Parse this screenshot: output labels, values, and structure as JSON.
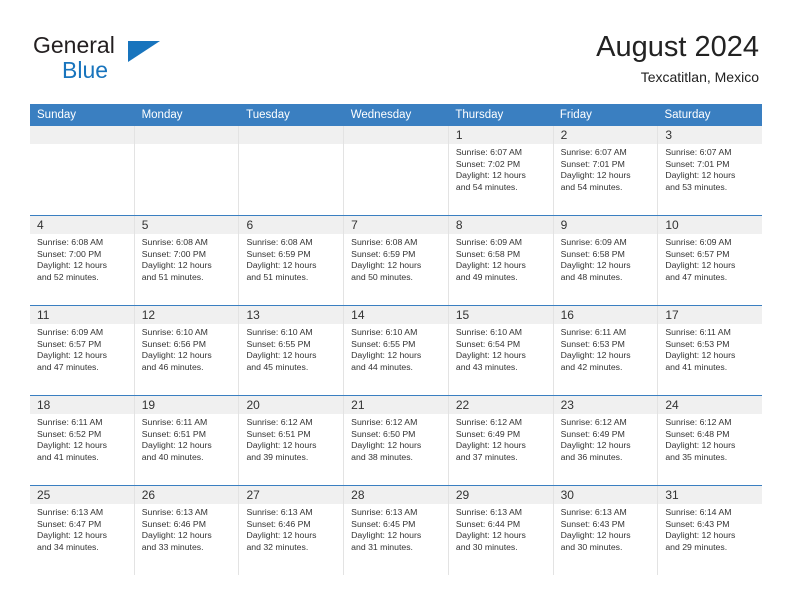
{
  "brand": {
    "name_top": "General",
    "name_bottom": "Blue",
    "triangle_color": "#1874bd",
    "top_color": "#231f20"
  },
  "header": {
    "title": "August 2024",
    "subtitle": "Texcatitlan, Mexico"
  },
  "theme": {
    "header_row_bg": "#3a7fc1",
    "header_row_text": "#ffffff",
    "daynum_bg": "#f0f0f0",
    "cell_border": "#e3e3e3",
    "row_separator": "#3a7fc1"
  },
  "weekdays": [
    "Sunday",
    "Monday",
    "Tuesday",
    "Wednesday",
    "Thursday",
    "Friday",
    "Saturday"
  ],
  "weeks": [
    [
      {
        "day": "",
        "sunrise": "",
        "sunset": "",
        "daylight1": "",
        "daylight2": ""
      },
      {
        "day": "",
        "sunrise": "",
        "sunset": "",
        "daylight1": "",
        "daylight2": ""
      },
      {
        "day": "",
        "sunrise": "",
        "sunset": "",
        "daylight1": "",
        "daylight2": ""
      },
      {
        "day": "",
        "sunrise": "",
        "sunset": "",
        "daylight1": "",
        "daylight2": ""
      },
      {
        "day": "1",
        "sunrise": "Sunrise: 6:07 AM",
        "sunset": "Sunset: 7:02 PM",
        "daylight1": "Daylight: 12 hours",
        "daylight2": "and 54 minutes."
      },
      {
        "day": "2",
        "sunrise": "Sunrise: 6:07 AM",
        "sunset": "Sunset: 7:01 PM",
        "daylight1": "Daylight: 12 hours",
        "daylight2": "and 54 minutes."
      },
      {
        "day": "3",
        "sunrise": "Sunrise: 6:07 AM",
        "sunset": "Sunset: 7:01 PM",
        "daylight1": "Daylight: 12 hours",
        "daylight2": "and 53 minutes."
      }
    ],
    [
      {
        "day": "4",
        "sunrise": "Sunrise: 6:08 AM",
        "sunset": "Sunset: 7:00 PM",
        "daylight1": "Daylight: 12 hours",
        "daylight2": "and 52 minutes."
      },
      {
        "day": "5",
        "sunrise": "Sunrise: 6:08 AM",
        "sunset": "Sunset: 7:00 PM",
        "daylight1": "Daylight: 12 hours",
        "daylight2": "and 51 minutes."
      },
      {
        "day": "6",
        "sunrise": "Sunrise: 6:08 AM",
        "sunset": "Sunset: 6:59 PM",
        "daylight1": "Daylight: 12 hours",
        "daylight2": "and 51 minutes."
      },
      {
        "day": "7",
        "sunrise": "Sunrise: 6:08 AM",
        "sunset": "Sunset: 6:59 PM",
        "daylight1": "Daylight: 12 hours",
        "daylight2": "and 50 minutes."
      },
      {
        "day": "8",
        "sunrise": "Sunrise: 6:09 AM",
        "sunset": "Sunset: 6:58 PM",
        "daylight1": "Daylight: 12 hours",
        "daylight2": "and 49 minutes."
      },
      {
        "day": "9",
        "sunrise": "Sunrise: 6:09 AM",
        "sunset": "Sunset: 6:58 PM",
        "daylight1": "Daylight: 12 hours",
        "daylight2": "and 48 minutes."
      },
      {
        "day": "10",
        "sunrise": "Sunrise: 6:09 AM",
        "sunset": "Sunset: 6:57 PM",
        "daylight1": "Daylight: 12 hours",
        "daylight2": "and 47 minutes."
      }
    ],
    [
      {
        "day": "11",
        "sunrise": "Sunrise: 6:09 AM",
        "sunset": "Sunset: 6:57 PM",
        "daylight1": "Daylight: 12 hours",
        "daylight2": "and 47 minutes."
      },
      {
        "day": "12",
        "sunrise": "Sunrise: 6:10 AM",
        "sunset": "Sunset: 6:56 PM",
        "daylight1": "Daylight: 12 hours",
        "daylight2": "and 46 minutes."
      },
      {
        "day": "13",
        "sunrise": "Sunrise: 6:10 AM",
        "sunset": "Sunset: 6:55 PM",
        "daylight1": "Daylight: 12 hours",
        "daylight2": "and 45 minutes."
      },
      {
        "day": "14",
        "sunrise": "Sunrise: 6:10 AM",
        "sunset": "Sunset: 6:55 PM",
        "daylight1": "Daylight: 12 hours",
        "daylight2": "and 44 minutes."
      },
      {
        "day": "15",
        "sunrise": "Sunrise: 6:10 AM",
        "sunset": "Sunset: 6:54 PM",
        "daylight1": "Daylight: 12 hours",
        "daylight2": "and 43 minutes."
      },
      {
        "day": "16",
        "sunrise": "Sunrise: 6:11 AM",
        "sunset": "Sunset: 6:53 PM",
        "daylight1": "Daylight: 12 hours",
        "daylight2": "and 42 minutes."
      },
      {
        "day": "17",
        "sunrise": "Sunrise: 6:11 AM",
        "sunset": "Sunset: 6:53 PM",
        "daylight1": "Daylight: 12 hours",
        "daylight2": "and 41 minutes."
      }
    ],
    [
      {
        "day": "18",
        "sunrise": "Sunrise: 6:11 AM",
        "sunset": "Sunset: 6:52 PM",
        "daylight1": "Daylight: 12 hours",
        "daylight2": "and 41 minutes."
      },
      {
        "day": "19",
        "sunrise": "Sunrise: 6:11 AM",
        "sunset": "Sunset: 6:51 PM",
        "daylight1": "Daylight: 12 hours",
        "daylight2": "and 40 minutes."
      },
      {
        "day": "20",
        "sunrise": "Sunrise: 6:12 AM",
        "sunset": "Sunset: 6:51 PM",
        "daylight1": "Daylight: 12 hours",
        "daylight2": "and 39 minutes."
      },
      {
        "day": "21",
        "sunrise": "Sunrise: 6:12 AM",
        "sunset": "Sunset: 6:50 PM",
        "daylight1": "Daylight: 12 hours",
        "daylight2": "and 38 minutes."
      },
      {
        "day": "22",
        "sunrise": "Sunrise: 6:12 AM",
        "sunset": "Sunset: 6:49 PM",
        "daylight1": "Daylight: 12 hours",
        "daylight2": "and 37 minutes."
      },
      {
        "day": "23",
        "sunrise": "Sunrise: 6:12 AM",
        "sunset": "Sunset: 6:49 PM",
        "daylight1": "Daylight: 12 hours",
        "daylight2": "and 36 minutes."
      },
      {
        "day": "24",
        "sunrise": "Sunrise: 6:12 AM",
        "sunset": "Sunset: 6:48 PM",
        "daylight1": "Daylight: 12 hours",
        "daylight2": "and 35 minutes."
      }
    ],
    [
      {
        "day": "25",
        "sunrise": "Sunrise: 6:13 AM",
        "sunset": "Sunset: 6:47 PM",
        "daylight1": "Daylight: 12 hours",
        "daylight2": "and 34 minutes."
      },
      {
        "day": "26",
        "sunrise": "Sunrise: 6:13 AM",
        "sunset": "Sunset: 6:46 PM",
        "daylight1": "Daylight: 12 hours",
        "daylight2": "and 33 minutes."
      },
      {
        "day": "27",
        "sunrise": "Sunrise: 6:13 AM",
        "sunset": "Sunset: 6:46 PM",
        "daylight1": "Daylight: 12 hours",
        "daylight2": "and 32 minutes."
      },
      {
        "day": "28",
        "sunrise": "Sunrise: 6:13 AM",
        "sunset": "Sunset: 6:45 PM",
        "daylight1": "Daylight: 12 hours",
        "daylight2": "and 31 minutes."
      },
      {
        "day": "29",
        "sunrise": "Sunrise: 6:13 AM",
        "sunset": "Sunset: 6:44 PM",
        "daylight1": "Daylight: 12 hours",
        "daylight2": "and 30 minutes."
      },
      {
        "day": "30",
        "sunrise": "Sunrise: 6:13 AM",
        "sunset": "Sunset: 6:43 PM",
        "daylight1": "Daylight: 12 hours",
        "daylight2": "and 30 minutes."
      },
      {
        "day": "31",
        "sunrise": "Sunrise: 6:14 AM",
        "sunset": "Sunset: 6:43 PM",
        "daylight1": "Daylight: 12 hours",
        "daylight2": "and 29 minutes."
      }
    ]
  ]
}
